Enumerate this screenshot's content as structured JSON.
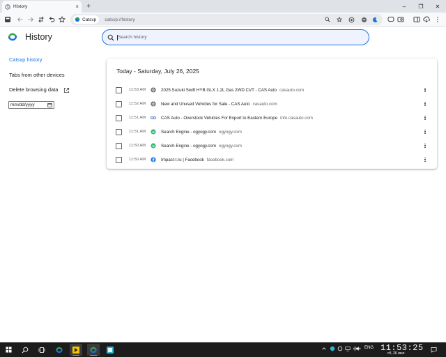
{
  "tab": {
    "title": "History",
    "close": "×",
    "new_tab": "+"
  },
  "window_controls": {
    "minimize": "–",
    "maximize": "❐",
    "close": "✕"
  },
  "omnibox": {
    "chip_label": "Catsxp",
    "url": "catsxp://history"
  },
  "sidebar": {
    "brand_name": "History",
    "items": [
      {
        "label": "Catsxp history",
        "active": true
      },
      {
        "label": "Tabs from other devices",
        "active": false
      },
      {
        "label": "Delete browsing data",
        "active": false
      }
    ],
    "date_placeholder": "mm/dd/yyyy"
  },
  "search": {
    "placeholder": "Search history"
  },
  "history": {
    "heading": "Today - Saturday, July 26, 2025",
    "rows": [
      {
        "time": "11:53 AM",
        "title": "2025 Suzuki Swift HYB GLX 1.2L Gas 2WD CVT - CAS Auto",
        "domain": "casauto.com",
        "favicon": "globe-icon"
      },
      {
        "time": "11:52 AM",
        "title": "New and Unused Vehicles for Sale - CAS Auto",
        "domain": "casauto.com",
        "favicon": "globe-icon"
      },
      {
        "time": "11:51 AM",
        "title": "CAS Auto - Overstock Vehicles For Export to Eastern Europe",
        "domain": "info.casauto.com",
        "favicon": "link-icon"
      },
      {
        "time": "11:51 AM",
        "title": "Search Engine - ogyogy.com",
        "domain": "ogyogy.com",
        "favicon": "ogyogy-icon"
      },
      {
        "time": "11:50 AM",
        "title": "Search Engine - ogyogy.com",
        "domain": "ogyogy.com",
        "favicon": "ogyogy-icon"
      },
      {
        "time": "11:50 AM",
        "title": "Impact-t.ru | Facebook",
        "domain": "facebook.com",
        "favicon": "facebook-icon"
      }
    ]
  },
  "taskbar": {
    "lang": "ENG",
    "time": "11:53:25",
    "date": "сб, 26 июл"
  },
  "colors": {
    "accent": "#1a73e8",
    "taskbar": "#1c1c1c",
    "tabstrip": "#dfe3e7"
  }
}
